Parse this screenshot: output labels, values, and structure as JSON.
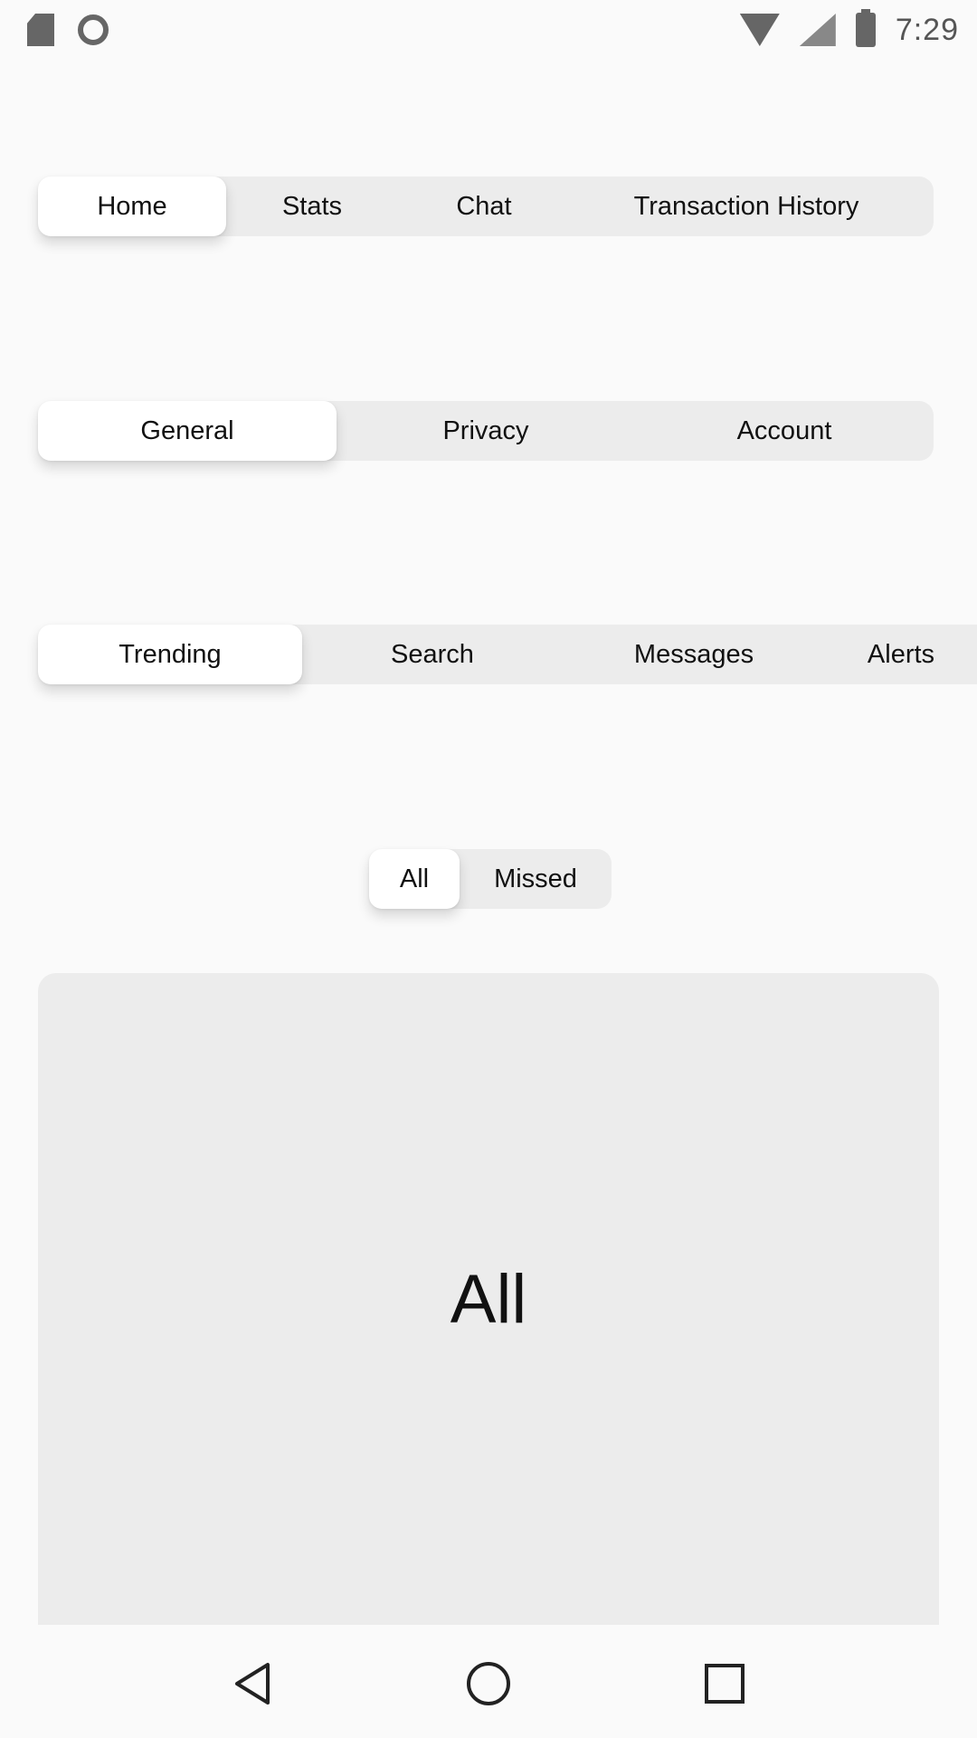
{
  "status_bar": {
    "time": "7:29",
    "icons": [
      "sd-card-icon",
      "sync-ring-icon",
      "wifi-icon",
      "cell-signal-icon",
      "battery-icon"
    ]
  },
  "segmented_controls": [
    {
      "items": [
        "Home",
        "Stats",
        "Chat",
        "Transaction History"
      ],
      "selected": "Home"
    },
    {
      "items": [
        "General",
        "Privacy",
        "Account"
      ],
      "selected": "General"
    },
    {
      "items": [
        "Trending",
        "Search",
        "Messages",
        "Alerts"
      ],
      "selected": "Trending"
    },
    {
      "items": [
        "All",
        "Missed"
      ],
      "selected": "All"
    }
  ],
  "content": {
    "label": "All"
  },
  "nav_bar": {
    "icons": [
      "back-icon",
      "home-icon",
      "recents-icon"
    ]
  },
  "colors": {
    "background": "#fafafa",
    "segment_track": "#ececec",
    "segment_active": "#ffffff",
    "text": "#111111"
  }
}
